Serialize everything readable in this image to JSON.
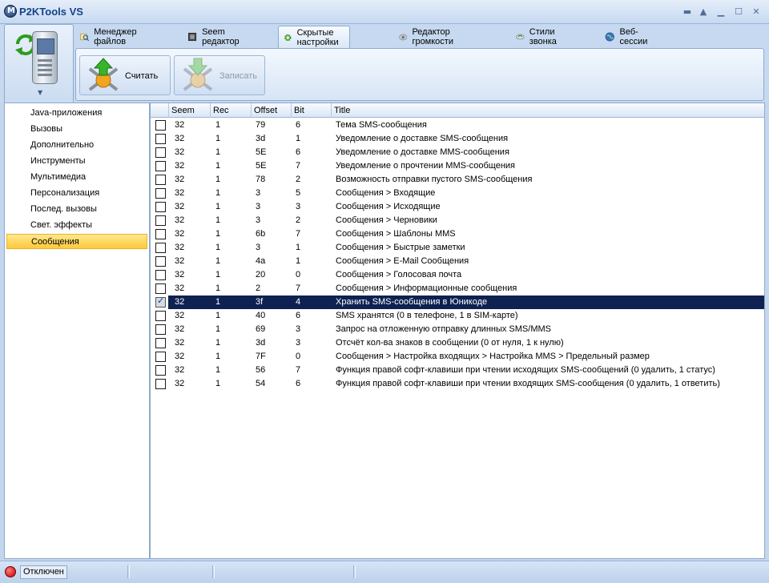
{
  "window": {
    "title": "P2KTools VS"
  },
  "tabs": [
    {
      "label": "Менеджер файлов",
      "icon": "file-manager-icon"
    },
    {
      "label": "Seem редактор",
      "icon": "seem-editor-icon"
    },
    {
      "label": "Скрытые настройки",
      "icon": "hidden-settings-gear-icon"
    },
    {
      "label": "Редактор громкости",
      "icon": "volume-editor-icon"
    },
    {
      "label": "Стили звонка",
      "icon": "ring-styles-icon"
    },
    {
      "label": "Веб-сессии",
      "icon": "web-sessions-globe-icon"
    }
  ],
  "toolbar": {
    "read_label": "Считать",
    "write_label": "Записать"
  },
  "sidebar": {
    "items": [
      {
        "label": "Java-приложения"
      },
      {
        "label": "Вызовы"
      },
      {
        "label": "Дополнительно"
      },
      {
        "label": "Инструменты"
      },
      {
        "label": "Мультимедиа"
      },
      {
        "label": "Персонализация"
      },
      {
        "label": "Послед. вызовы"
      },
      {
        "label": "Свет. эффекты"
      },
      {
        "label": "Сообщения"
      }
    ],
    "selected": "Сообщения"
  },
  "grid": {
    "columns": [
      "Seem",
      "Rec",
      "Offset",
      "Bit",
      "Title"
    ],
    "rows": [
      {
        "seem": "32",
        "rec": "1",
        "offset": "79",
        "bit": "6",
        "title": "Тема SMS-сообщения",
        "checked": false
      },
      {
        "seem": "32",
        "rec": "1",
        "offset": "3d",
        "bit": "1",
        "title": "Уведомление о доставке SMS-сообщения",
        "checked": false
      },
      {
        "seem": "32",
        "rec": "1",
        "offset": "5E",
        "bit": "6",
        "title": "Уведомление о доставке MMS-сообщения",
        "checked": false
      },
      {
        "seem": "32",
        "rec": "1",
        "offset": "5E",
        "bit": "7",
        "title": "Уведомление о прочтении MMS-сообщения",
        "checked": false
      },
      {
        "seem": "32",
        "rec": "1",
        "offset": "78",
        "bit": "2",
        "title": "Возможность отправки пустого SMS-сообщения",
        "checked": false
      },
      {
        "seem": "32",
        "rec": "1",
        "offset": "3",
        "bit": "5",
        "title": "Сообщения > Входящие",
        "checked": false
      },
      {
        "seem": "32",
        "rec": "1",
        "offset": "3",
        "bit": "3",
        "title": "Сообщения > Исходящие",
        "checked": false
      },
      {
        "seem": "32",
        "rec": "1",
        "offset": "3",
        "bit": "2",
        "title": "Сообщения > Черновики",
        "checked": false
      },
      {
        "seem": "32",
        "rec": "1",
        "offset": "6b",
        "bit": "7",
        "title": "Сообщения > Шаблоны MMS",
        "checked": false
      },
      {
        "seem": "32",
        "rec": "1",
        "offset": "3",
        "bit": "1",
        "title": "Сообщения > Быстрые заметки",
        "checked": false
      },
      {
        "seem": "32",
        "rec": "1",
        "offset": "4a",
        "bit": "1",
        "title": "Сообщения > E-Mail Сообщения",
        "checked": false
      },
      {
        "seem": "32",
        "rec": "1",
        "offset": "20",
        "bit": "0",
        "title": "Сообщения > Голосовая почта",
        "checked": false
      },
      {
        "seem": "32",
        "rec": "1",
        "offset": "2",
        "bit": "7",
        "title": "Сообщения > Информационные сообщения",
        "checked": false
      },
      {
        "seem": "32",
        "rec": "1",
        "offset": "3f",
        "bit": "4",
        "title": "Хранить SMS-сообщения в Юникоде",
        "checked": true,
        "selected": true
      },
      {
        "seem": "32",
        "rec": "1",
        "offset": "40",
        "bit": "6",
        "title": "SMS хранятся (0 в телефоне, 1 в SIM-карте)",
        "checked": false
      },
      {
        "seem": "32",
        "rec": "1",
        "offset": "69",
        "bit": "3",
        "title": "Запрос на отложенную отправку длинных SMS/MMS",
        "checked": false
      },
      {
        "seem": "32",
        "rec": "1",
        "offset": "3d",
        "bit": "3",
        "title": "Отсчёт кол-ва знаков в сообщении (0 от нуля, 1 к нулю)",
        "checked": false
      },
      {
        "seem": "32",
        "rec": "1",
        "offset": "7F",
        "bit": "0",
        "title": "Сообщения > Настройка входящих > Настройка MMS > Предельный размер",
        "checked": false
      },
      {
        "seem": "32",
        "rec": "1",
        "offset": "56",
        "bit": "7",
        "title": "Функция правой софт-клавиши при чтении исходящих SMS-сообщений (0 удалить, 1 статус)",
        "checked": false
      },
      {
        "seem": "32",
        "rec": "1",
        "offset": "54",
        "bit": "6",
        "title": "Функция правой софт-клавиши при чтении входящих SMS-сообщения (0 удалить, 1 ответить)",
        "checked": false
      }
    ]
  },
  "status": {
    "connection": "Отключен",
    "indicator_color": "#d40000"
  },
  "colors": {
    "selection": "#0e2151",
    "accent": "#15428b",
    "tree_selected": "#ffc93a"
  }
}
